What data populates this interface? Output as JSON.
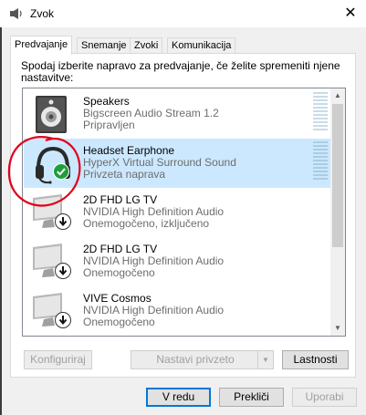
{
  "window": {
    "title": "Zvok",
    "close_glyph": "✕"
  },
  "tabs": [
    {
      "label": "Predvajanje",
      "active": true
    },
    {
      "label": "Snemanje",
      "active": false
    },
    {
      "label": "Zvoki",
      "active": false
    },
    {
      "label": "Komunikacija",
      "active": false
    }
  ],
  "instruction": "Spodaj izberite napravo za predvajanje, če želite spremeniti njene nastavitve:",
  "devices": [
    {
      "name": "Speakers",
      "description": "Bigscreen Audio Stream 1.2",
      "status": "Pripravljen",
      "icon": "speaker-icon",
      "selected": false
    },
    {
      "name": "Headset Earphone",
      "description": "HyperX Virtual Surround Sound",
      "status": "Privzeta naprava",
      "icon": "headset-icon",
      "badge": "default-check-icon",
      "selected": true
    },
    {
      "name": "2D FHD LG TV",
      "description": "NVIDIA High Definition Audio",
      "status": "Onemogočeno, izključeno",
      "icon": "monitor-icon",
      "badge": "disabled-arrow-icon",
      "selected": false
    },
    {
      "name": "2D FHD LG TV",
      "description": "NVIDIA High Definition Audio",
      "status": "Onemogočeno",
      "icon": "monitor-icon",
      "badge": "disabled-arrow-icon",
      "selected": false
    },
    {
      "name": "VIVE Cosmos",
      "description": "NVIDIA High Definition Audio",
      "status": "Onemogočeno",
      "icon": "monitor-icon",
      "badge": "disabled-arrow-icon",
      "selected": false
    }
  ],
  "buttons": {
    "configure": "Konfiguriraj",
    "set_default": "Nastavi privzeto",
    "properties": "Lastnosti",
    "ok": "V redu",
    "cancel": "Prekliči",
    "apply": "Uporabi"
  },
  "colors": {
    "selection": "#cce8ff",
    "accent": "#0078d7",
    "annotation": "#e0001a",
    "check_badge": "#1f9e3a"
  }
}
